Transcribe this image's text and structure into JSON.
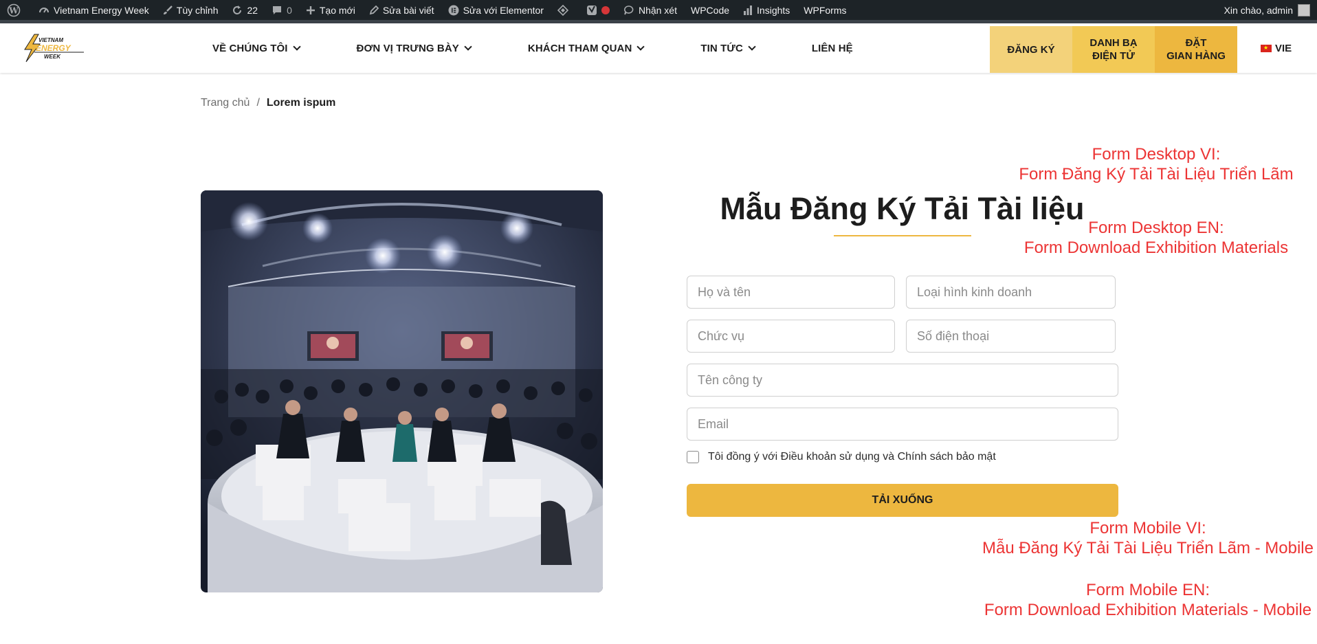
{
  "adminbar": {
    "site_name": "Vietnam Energy Week",
    "customize": "Tùy chỉnh",
    "updates_count": "22",
    "comments_count": "0",
    "new": "Tạo mới",
    "edit_post": "Sửa bài viết",
    "edit_elementor": "Sửa với Elementor",
    "comments": "Nhận xét",
    "wpcode": "WPCode",
    "insights": "Insights",
    "wpforms": "WPForms",
    "greeting": "Xin chào, admin"
  },
  "header": {
    "logo_text": [
      "VIETNAM",
      "ENERGY",
      "WEEK"
    ],
    "nav": [
      {
        "label": "VỀ CHÚNG TÔI",
        "dropdown": true
      },
      {
        "label": "ĐƠN VỊ TRƯNG BÀY",
        "dropdown": true
      },
      {
        "label": "KHÁCH THAM QUAN",
        "dropdown": true
      },
      {
        "label": "TIN TỨC",
        "dropdown": true
      },
      {
        "label": "LIÊN HỆ",
        "dropdown": false
      }
    ],
    "register": "ĐĂNG KÝ",
    "directory_line1": "DANH BẠ",
    "directory_line2": "ĐIỆN TỬ",
    "booth_line1": "ĐẶT",
    "booth_line2": "GIAN HÀNG",
    "language": "VIE"
  },
  "breadcrumb": {
    "home": "Trang chủ",
    "separator": "/",
    "current": "Lorem ispum"
  },
  "form": {
    "title": "Mẫu Đăng Ký Tải Tài liệu",
    "fields": {
      "full_name": {
        "placeholder": "Họ và tên",
        "value": ""
      },
      "business_type": {
        "placeholder": "Loại hình kinh doanh",
        "value": ""
      },
      "position": {
        "placeholder": "Chức vụ",
        "value": ""
      },
      "phone": {
        "placeholder": "Số điện thoại",
        "value": ""
      },
      "company": {
        "placeholder": "Tên công ty",
        "value": ""
      },
      "email": {
        "placeholder": "Email",
        "value": ""
      }
    },
    "consent_label": "Tôi đồng ý với Điều khoản sử dụng và Chính sách bảo mật",
    "consent_checked": false,
    "submit": "TẢI XUỐNG"
  },
  "annotations": {
    "desktop_vi_line1": "Form Desktop VI:",
    "desktop_vi_line2": "Form Đăng Ký Tải Tài Liệu Triển Lãm",
    "desktop_en_line1": "Form Desktop EN:",
    "desktop_en_line2": "Form Download Exhibition Materials",
    "mobile_vi_line1": "Form Mobile VI:",
    "mobile_vi_line2": "Mẫu Đăng Ký Tải Tài Liệu Triển Lãm - Mobile",
    "mobile_en_line1": "Form Mobile EN:",
    "mobile_en_line2": "Form Download Exhibition Materials - Mobile"
  },
  "colors": {
    "accent": "#edb73f",
    "register_bg": "#f3d27a",
    "directory_bg": "#f2c955",
    "annotation": "#ec3434",
    "adminbar_bg": "#1d2327"
  }
}
